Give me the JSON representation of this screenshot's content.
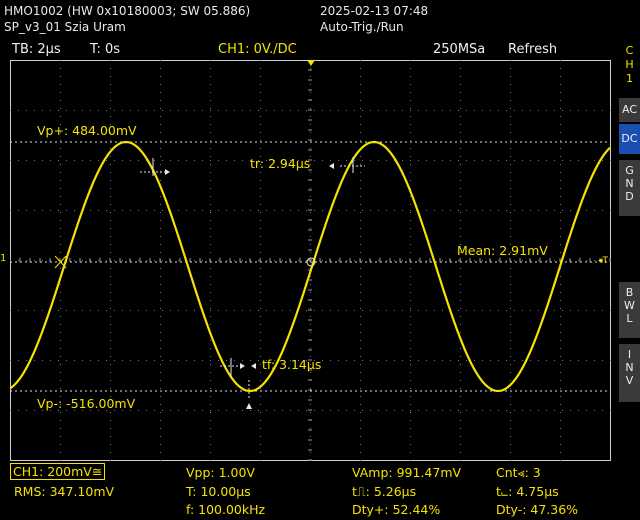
{
  "header": {
    "device": "HMO1002 (HW 0x10180003; SW 05.886)",
    "file": "SP_v3_01 Szia Uram",
    "datetime": "2025-02-13 07:48",
    "trigger_mode": "Auto-Trig./Run"
  },
  "status_bar": {
    "timebase": "TB: 2µs",
    "trig_time": "T: 0s",
    "channel": "CH1: 0V./DC",
    "sample_rate": "250MSa",
    "acq_mode": "Refresh"
  },
  "side_menu": {
    "channel_letters": [
      "C",
      "H",
      "1"
    ],
    "ac": "AC",
    "dc": "DC",
    "gnd_letters": [
      "G",
      "N",
      "D"
    ],
    "bwl_letters": [
      "B",
      "W",
      "L"
    ],
    "inv_letters": [
      "I",
      "N",
      "V"
    ]
  },
  "waveform": {
    "vp_plus": "Vp+: 484.00mV",
    "vp_minus": "Vp-: -516.00mV",
    "mean": "Mean: 2.91mV",
    "rise_time": "tr: 2.94µs",
    "fall_time": "tf: 3.14µs",
    "ground_marker": "1",
    "trigger_marker": "T",
    "color": "#f4e300"
  },
  "measurements": {
    "ch1_scale": "CH1: 200mV≅",
    "rms": "RMS: 347.10mV",
    "vpp": "Vpp: 1.00V",
    "period": "T: 10.00µs",
    "frequency": "f: 100.00kHz",
    "vamp": "VAmp: 991.47mV",
    "pulse_pos": "t⎍: 5.26µs",
    "duty_pos": "Dty+: 52.44%",
    "count": "Cnt⪡: 3",
    "pulse_neg": "t⨽: 4.75µs",
    "duty_neg": "Dty-: 47.36%"
  }
}
